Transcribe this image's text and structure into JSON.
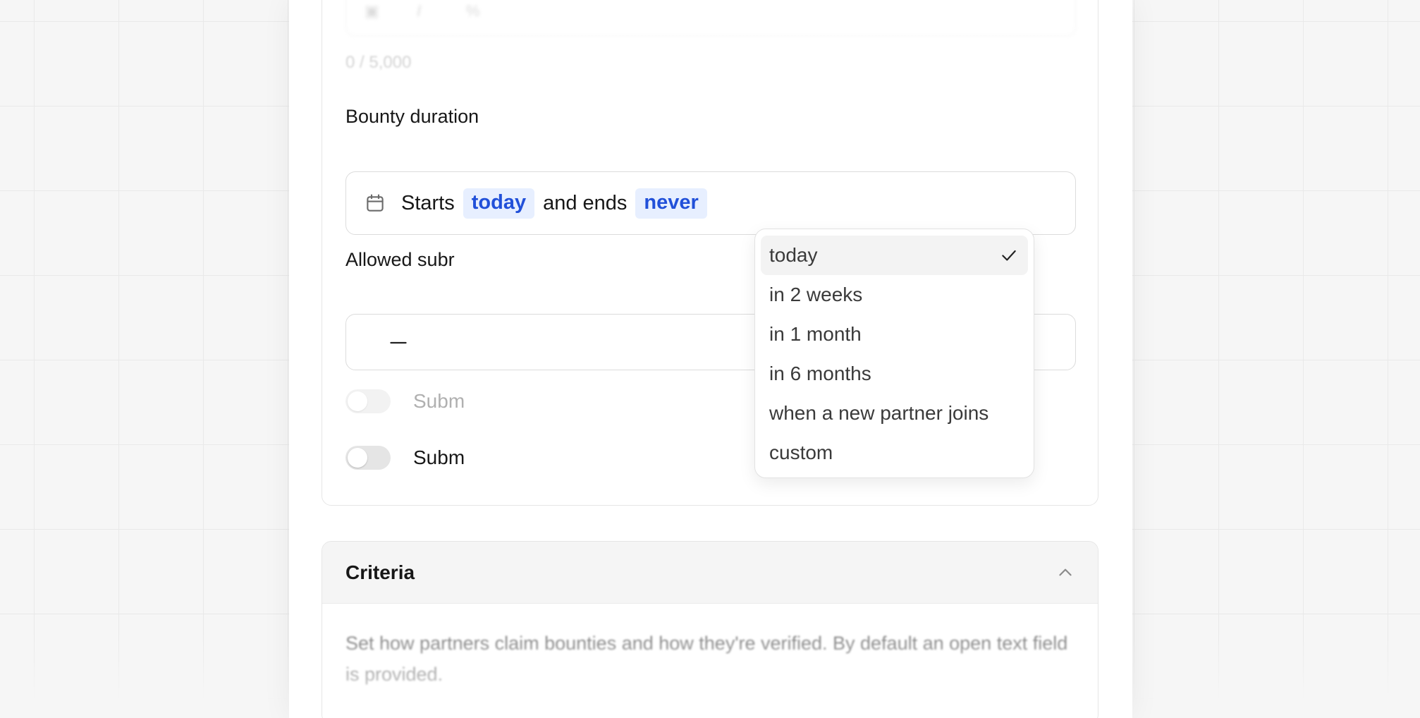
{
  "editor": {
    "char_count": "0 / 5,000",
    "toolbar_icons": [
      "image-icon",
      "italic-icon",
      "link-icon"
    ]
  },
  "bounty_duration": {
    "label": "Bounty duration",
    "starts_prefix": "Starts",
    "start_value": "today",
    "middle_text": "and ends",
    "end_value": "never"
  },
  "submissions": {
    "label_visible": "Allowed subr",
    "decrement_icon": "minus-icon",
    "increment_icon": "plus-icon"
  },
  "toggles": [
    {
      "label_visible": "Subm",
      "enabled": false,
      "on": false
    },
    {
      "label_visible": "Subm",
      "enabled": true,
      "on": false
    }
  ],
  "criteria": {
    "title": "Criteria",
    "description": "Set how partners claim bounties and how they're verified. By default an open text field is provided.",
    "chevron_icon": "chevron-up-icon"
  },
  "dropdown": {
    "selected": "today",
    "options": [
      "today",
      "in 2 weeks",
      "in 1 month",
      "in 6 months",
      "when a new partner joins",
      "custom"
    ]
  },
  "colors": {
    "accent_text": "#2150d9",
    "accent_bg": "#e7efff"
  }
}
